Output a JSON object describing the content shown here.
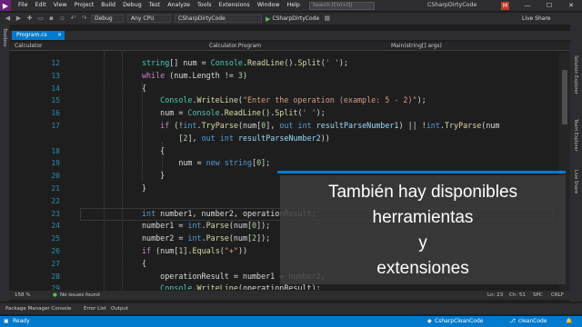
{
  "menu": {
    "items": [
      "File",
      "Edit",
      "View",
      "Project",
      "Build",
      "Debug",
      "Test",
      "Analyze",
      "Tools",
      "Extensions",
      "Window",
      "Help"
    ],
    "search_placeholder": "Search (Ctrl+Q)",
    "solution_title": "CSharpDirtyCode",
    "avatar": "M"
  },
  "toolbar": {
    "config": "Debug",
    "platform": "Any CPU",
    "project": "CSharpDirtyCode",
    "run_label": "CSharpDirtyCode",
    "live_share": "Live Share"
  },
  "side": {
    "left_label": "Toolbox",
    "right_labels": [
      "Solution Explorer",
      "Team Explorer",
      "Live Share"
    ]
  },
  "tab": {
    "label": "Program.cs",
    "close": "×"
  },
  "navbar": {
    "project": "Calculator",
    "class": "Calculator.Program",
    "method": "Main(string[] args)"
  },
  "editor": {
    "line_numbers": [
      "12",
      "13",
      "14",
      "15",
      "16",
      "17",
      "",
      "18",
      "19",
      "20",
      "21",
      "22",
      "23",
      "24",
      "25",
      "26",
      "27",
      "28",
      "29"
    ]
  },
  "subtitle": {
    "lines": [
      "También hay disponibles",
      "herramientas",
      "y",
      "extensiones"
    ]
  },
  "status": {
    "zoom": "158 %",
    "issues": "No issues found",
    "line": "Ln: 23",
    "col": "Ch: 51",
    "spc": "SPC",
    "crlf": "CRLF",
    "ready": "Ready",
    "repo": "CsharpCleanCode",
    "branch": "cleanCode"
  },
  "bottom_tabs": [
    "Package Manager Console",
    "Error List",
    "Output"
  ],
  "colors": {
    "accent": "#007acc",
    "background": "#1e1e1e",
    "chrome": "#2d2d30"
  }
}
